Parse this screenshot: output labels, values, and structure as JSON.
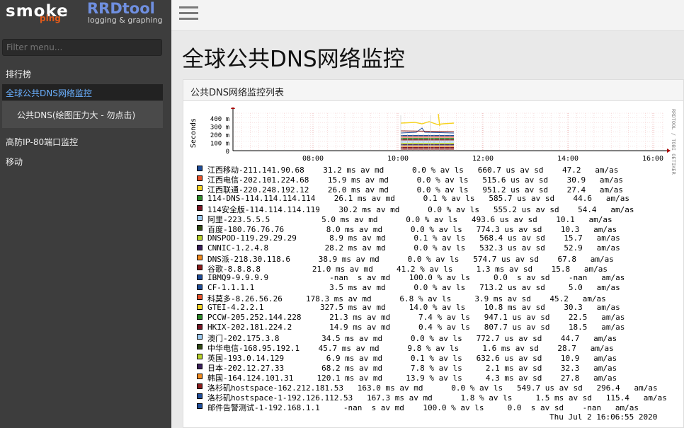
{
  "logo": {
    "smoke": "smoke",
    "ping": "ping",
    "rrd": "RRDtool",
    "rrd_sub": "logging & graphing"
  },
  "sidebar": {
    "filter_placeholder": "Filter menu...",
    "items": [
      {
        "label": "排行榜"
      },
      {
        "label": "全球公共DNS网络监控"
      },
      {
        "label": "公共DNS(绘图压力大 - 勿点击)"
      },
      {
        "label": "高防IP-80端口监控"
      },
      {
        "label": "移动"
      }
    ]
  },
  "page": {
    "title": "全球公共DNS网络监控",
    "panel_title": "公共DNS网络监控列表"
  },
  "chart_data": {
    "type": "line",
    "ylabel": "Seconds",
    "y_ticks": [
      "400 m",
      "300 m",
      "200 m",
      "100 m",
      "0"
    ],
    "x_ticks": [
      "08:00",
      "10:00",
      "12:00",
      "14:00",
      "16:00"
    ],
    "side_label": "RRDTOOL / TOBI OETIKER",
    "timestamp": "Thu Jul  2 16:06:55 2020",
    "series": [
      {
        "name": "江西移动-211.141.90.68",
        "color": "#1f4e9a",
        "stats": "    31.2 ms av md      0.0 % av ls   660.7 us av sd    47.2   am/as"
      },
      {
        "name": "江西电信-202.101.224.68",
        "color": "#e8542a",
        "stats": "    15.9 ms av md      0.0 % av ls   515.6 us av sd    30.9   am/as"
      },
      {
        "name": "江西联通-220.248.192.12",
        "color": "#f6d21f",
        "stats": "    26.0 ms av md      0.0 % av ls   951.2 us av sd    27.4   am/as"
      },
      {
        "name": "114-DNS-114.114.114.114",
        "color": "#2f8a2a",
        "stats": "    26.1 ms av md      0.1 % av ls   585.7 us av sd    44.6   am/as"
      },
      {
        "name": "114安全版-114.114.114.119",
        "color": "#7a1626",
        "stats": "    30.2 ms av md      0.0 % av ls   555.2 us av sd    54.4   am/as"
      },
      {
        "name": "阿里-223.5.5.5",
        "color": "#9ccaf0",
        "stats": "           5.0 ms av md      0.0 % av ls   493.6 us av sd    10.1   am/as"
      },
      {
        "name": "百度-180.76.76.76",
        "color": "#314a12",
        "stats": "         8.0 ms av md      0.0 % av ls   774.3 us av sd    10.3   am/as"
      },
      {
        "name": "DNSPOD-119.29.29.29",
        "color": "#b7d12a",
        "stats": "       8.9 ms av md      0.1 % av ls   568.4 us av sd    15.7   am/as"
      },
      {
        "name": "CNNIC-1.2.4.8",
        "color": "#3a1f5c",
        "stats": "            28.2 ms av md      0.0 % av ls   532.3 us av sd    52.9   am/as"
      },
      {
        "name": "DNS派-218.30.118.6",
        "color": "#f08a1e",
        "stats": "      38.9 ms av md      0.0 % av ls   574.7 us av sd    67.8   am/as"
      },
      {
        "name": "谷歌-8.8.8.8",
        "color": "#8a1c1c",
        "stats": "           21.0 ms av md     41.2 % av ls     1.3 ms av sd    15.8   am/as"
      },
      {
        "name": "IBMQ9-9.9.9.9",
        "color": "#1f4e9a",
        "stats": "             -nan  s av md    100.0 % av ls     0.0  s av sd    -nan   am/as"
      },
      {
        "name": "CF-1.1.1.1",
        "color": "#1f4e9a",
        "stats": "                3.5 ms av md      0.0 % av ls   713.2 us av sd     5.0   am/as"
      },
      {
        "name": "科莫多-8.26.56.26",
        "color": "#e8542a",
        "stats": "     178.3 ms av md      6.8 % av ls     3.9 ms av sd    45.2   am/as"
      },
      {
        "name": "GTEI-4.2.2.1",
        "color": "#f6d21f",
        "stats": "            327.5 ms av md     14.0 % av ls    10.8 ms av sd    30.3   am/as"
      },
      {
        "name": "PCCW-205.252.144.228",
        "color": "#2f8a2a",
        "stats": "      21.3 ms av md      7.4 % av ls   947.1 us av sd    22.5   am/as"
      },
      {
        "name": "HKIX-202.181.224.2",
        "color": "#7a1626",
        "stats": "        14.9 ms av md      0.4 % av ls   807.7 us av sd    18.5   am/as"
      },
      {
        "name": "澳门-202.175.3.8",
        "color": "#9ccaf0",
        "stats": "         34.5 ms av md      0.0 % av ls   772.7 us av sd    44.7   am/as"
      },
      {
        "name": "中华电信-168.95.192.1",
        "color": "#314a12",
        "stats": "    45.7 ms av md      9.8 % av ls     1.6 ms av sd    28.7   am/as"
      },
      {
        "name": "英国-193.0.14.129",
        "color": "#b7d12a",
        "stats": "         6.9 ms av md      0.1 % av ls   632.6 us av sd    10.9   am/as"
      },
      {
        "name": "日本-202.12.27.33",
        "color": "#3a1f5c",
        "stats": "        68.2 ms av md      7.8 % av ls     2.1 ms av sd    32.3   am/as"
      },
      {
        "name": "韩国-164.124.101.31",
        "color": "#f08a1e",
        "stats": "     120.1 ms av md     13.9 % av ls     4.3 ms av sd    27.8   am/as"
      },
      {
        "name": "洛杉矶hostspace-162.212.181.53",
        "color": "#8a1c1c",
        "stats": "   163.0 ms av md      0.0 % av ls   549.7 us av sd   296.4   am/as"
      },
      {
        "name": "洛杉矶hostspace-1-192.126.112.53",
        "color": "#1f4e9a",
        "stats": "   167.3 ms av md      1.8 % av ls     1.5 ms av sd   115.4   am/as"
      },
      {
        "name": "邮件告警测试-1-192.168.1.1",
        "color": "#1f4e9a",
        "stats": "     -nan  s av md    100.0 % av ls     0.0  s av sd    -nan   am/as"
      }
    ]
  }
}
